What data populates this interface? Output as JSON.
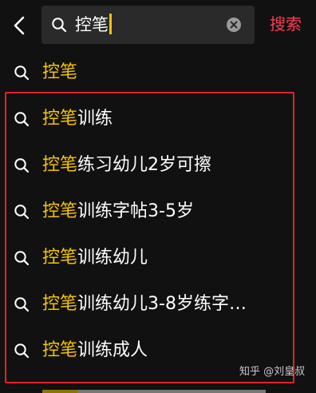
{
  "search": {
    "query": "控笔",
    "submit_label": "搜索"
  },
  "suggestions": [
    {
      "highlight": "控笔",
      "rest": ""
    },
    {
      "highlight": "控笔",
      "rest": "训练"
    },
    {
      "highlight": "控笔",
      "rest": "练习幼儿2岁可擦"
    },
    {
      "highlight": "控笔",
      "rest": "训练字帖3-5岁"
    },
    {
      "highlight": "控笔",
      "rest": "训练幼儿"
    },
    {
      "highlight": "控笔",
      "rest": "训练幼儿3-8岁练字…"
    },
    {
      "highlight": "控笔",
      "rest": "训练成人"
    }
  ],
  "watermark": "知乎 @刘皇叔",
  "colors": {
    "background": "#111111",
    "highlight_text": "#f5c400",
    "search_button": "#ff3b55",
    "annotation_box": "#e8202c"
  },
  "icons": {
    "back": "chevron-left-icon",
    "search": "search-icon",
    "clear": "clear-circle-icon"
  }
}
